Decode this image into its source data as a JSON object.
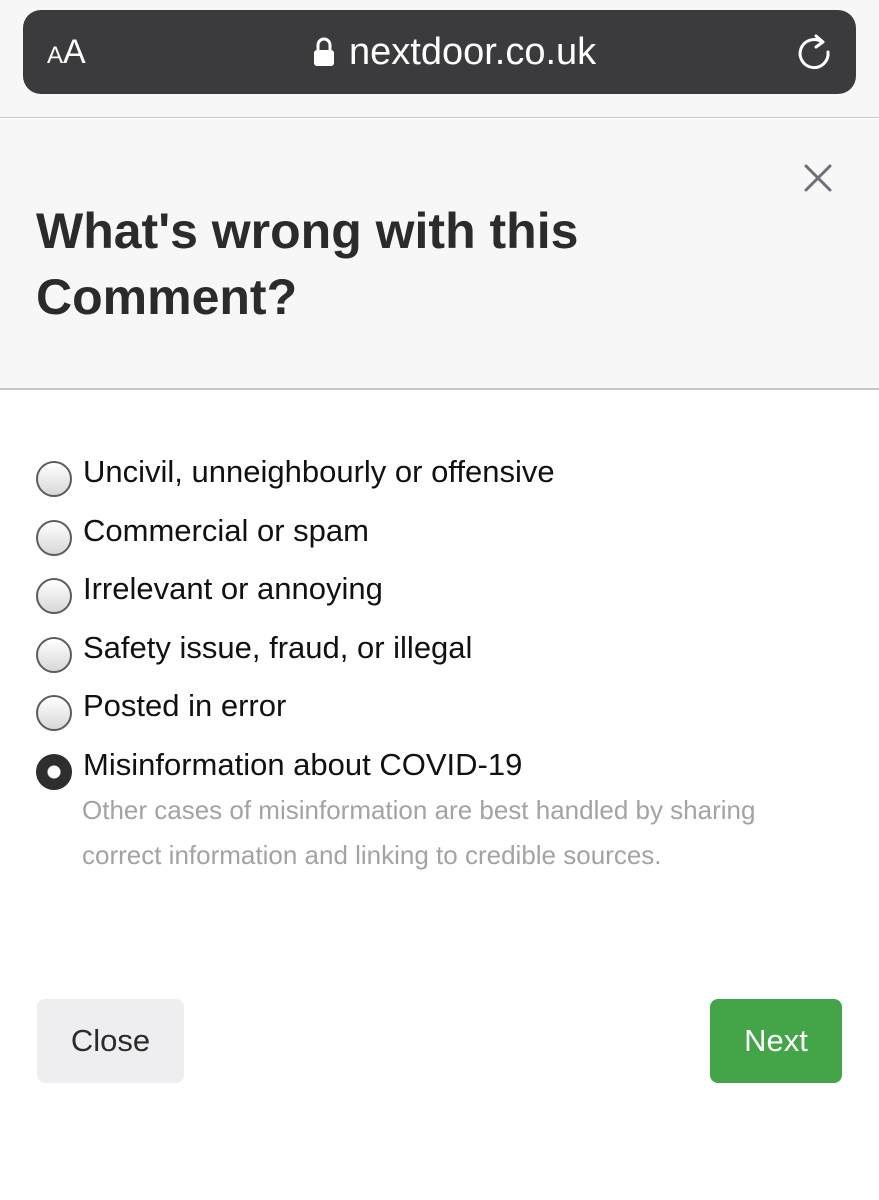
{
  "browser": {
    "text_size_label_small": "A",
    "text_size_label_large": "A",
    "url": "nextdoor.co.uk",
    "lock_icon": "lock-icon",
    "reload_icon": "reload-icon"
  },
  "modal": {
    "title": "What's wrong with this Comment?",
    "close_icon": "close-icon",
    "options": [
      {
        "label": "Uncivil, unneighbourly or offensive",
        "checked": false
      },
      {
        "label": "Commercial or spam",
        "checked": false
      },
      {
        "label": "Irrelevant or annoying",
        "checked": false
      },
      {
        "label": "Safety issue, fraud, or illegal",
        "checked": false
      },
      {
        "label": "Posted in error",
        "checked": false
      },
      {
        "label": "Misinformation about COVID-19",
        "checked": true
      }
    ],
    "helper_text": "Other cases of misinformation are best handled by sharing correct information and linking to credible sources.",
    "close_button_label": "Close",
    "next_button_label": "Next"
  },
  "colors": {
    "address_bar": "#3b3b3d",
    "next_button": "#43a548",
    "close_button": "#eeeef0",
    "helper_text": "#a3a3a3"
  }
}
